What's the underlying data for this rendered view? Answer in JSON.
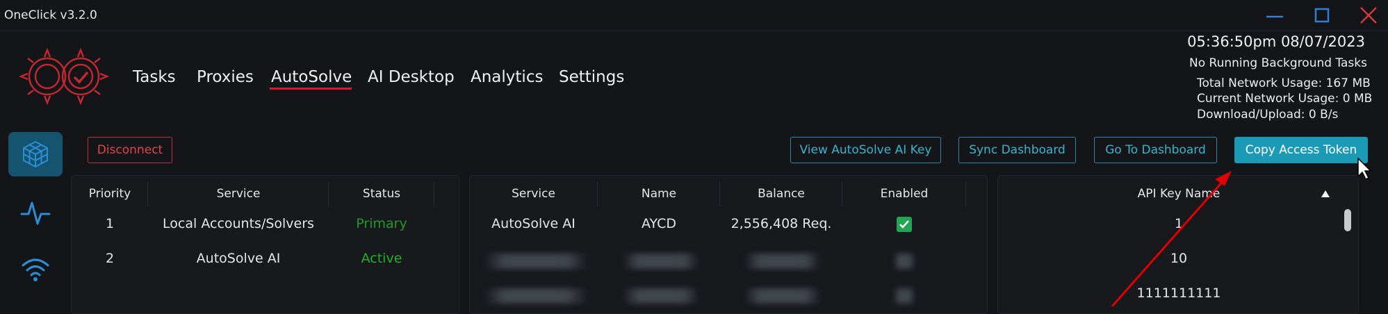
{
  "window": {
    "title": "OneClick v3.2.0",
    "accent_red": "#d01f2a",
    "accent_cyan": "#1a9ab4"
  },
  "nav": {
    "items": [
      {
        "label": "Tasks"
      },
      {
        "label": "Proxies"
      },
      {
        "label": "AutoSolve",
        "active": true
      },
      {
        "label": "AI Desktop"
      },
      {
        "label": "Analytics"
      },
      {
        "label": "Settings"
      }
    ]
  },
  "status": {
    "clock": "05:36:50pm 08/07/2023",
    "background_tasks": "No Running Background Tasks",
    "total_network": "Total Network Usage:  167 MB",
    "current_network": "Current Network Usage: 0 MB",
    "download_upload": "Download/Upload: 0 B/s"
  },
  "sidebar": {
    "items": [
      {
        "icon": "cube-icon",
        "active": true
      },
      {
        "icon": "activity-icon"
      },
      {
        "icon": "wifi-icon"
      }
    ]
  },
  "toolbar": {
    "disconnect": "Disconnect",
    "view_key": "View AutoSolve AI Key",
    "sync_dashboard": "Sync Dashboard",
    "go_dashboard": "Go To Dashboard",
    "copy_token": "Copy Access Token"
  },
  "priority_table": {
    "headers": {
      "priority": "Priority",
      "service": "Service",
      "status": "Status"
    },
    "rows": [
      {
        "priority": "1",
        "service": "Local Accounts/Solvers",
        "status": "Primary"
      },
      {
        "priority": "2",
        "service": "AutoSolve AI",
        "status": "Active"
      }
    ]
  },
  "service_table": {
    "headers": {
      "service": "Service",
      "name": "Name",
      "balance": "Balance",
      "enabled": "Enabled"
    },
    "rows": [
      {
        "service": "AutoSolve AI",
        "name": "AYCD",
        "balance": "2,556,408 Req.",
        "enabled": true
      }
    ]
  },
  "api_table": {
    "header": "API Key Name",
    "rows": [
      "1",
      "10",
      "1111111111"
    ]
  }
}
